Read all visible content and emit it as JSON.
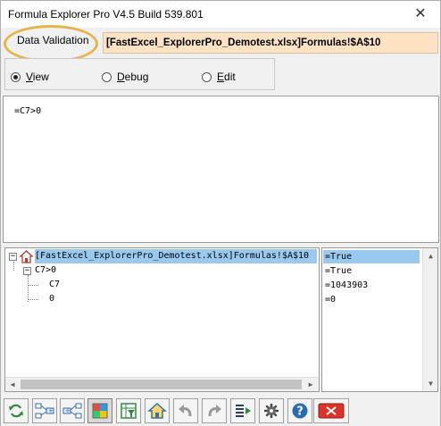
{
  "window": {
    "title": "Formula Explorer Pro V4.5 Build 539.801",
    "close_glyph": "✕"
  },
  "header": {
    "data_validation_label": "Data Validation",
    "cell_reference": "[FastExcel_ExplorerPro_Demotest.xlsx]Formulas!$A$10",
    "highlight_color": "#e6b54a",
    "reference_bg_color": "#fde2c4"
  },
  "modes": {
    "view": {
      "prefix": "",
      "accel": "V",
      "rest": "iew",
      "selected": true
    },
    "debug": {
      "prefix": "",
      "accel": "D",
      "rest": "ebug",
      "selected": false
    },
    "edit": {
      "prefix": "",
      "accel": "E",
      "rest": "dit",
      "selected": false
    }
  },
  "formula_text": "=C7>0",
  "tree": {
    "root": {
      "label": "[FastExcel_ExplorerPro_Demotest.xlsx]Formulas!$A$10",
      "expander": "−",
      "icon": "house-icon"
    },
    "child": {
      "label": "C7>0",
      "expander": "−"
    },
    "leaves": [
      {
        "label": "C7"
      },
      {
        "label": "0"
      }
    ]
  },
  "results": [
    {
      "value": "=True",
      "selected": true
    },
    {
      "value": "=True",
      "selected": false
    },
    {
      "value": "=1043903",
      "selected": false
    },
    {
      "value": "=0",
      "selected": false
    }
  ],
  "selection_color": "#99c9ef",
  "toolbar": {
    "buttons": [
      {
        "icon": "refresh-icon"
      },
      {
        "icon": "expand-precedents-icon"
      },
      {
        "icon": "expand-dependents-icon"
      },
      {
        "icon": "color-grid-icon"
      },
      {
        "icon": "filter-grid-icon"
      },
      {
        "icon": "home-icon"
      },
      {
        "icon": "undo-icon"
      },
      {
        "icon": "redo-icon"
      },
      {
        "icon": "list-arrange-icon"
      },
      {
        "icon": "settings-gear-icon"
      },
      {
        "icon": "help-icon"
      },
      {
        "icon": "close-red-icon"
      }
    ]
  }
}
